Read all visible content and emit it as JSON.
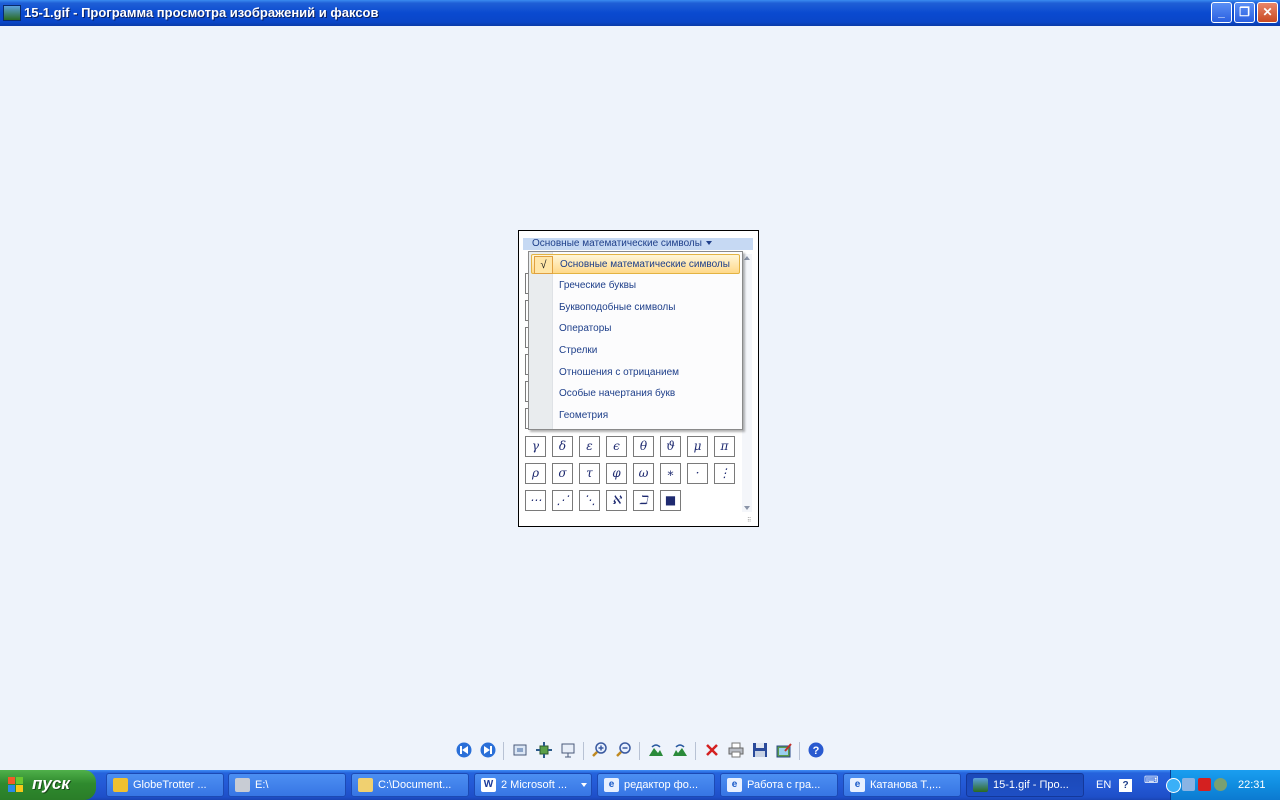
{
  "window": {
    "title": "15-1.gif - Программа просмотра изображений и факсов",
    "minimize_label": "_",
    "restore_label": "❐",
    "close_label": "✕"
  },
  "symbols_panel": {
    "header": "Основные математические символы",
    "menu_items": [
      {
        "label": "Основные математические символы",
        "selected": true
      },
      {
        "label": "Греческие буквы"
      },
      {
        "label": "Буквоподобные символы"
      },
      {
        "label": "Операторы"
      },
      {
        "label": "Стрелки"
      },
      {
        "label": "Отношения с отрицанием"
      },
      {
        "label": "Особые начертания букв"
      },
      {
        "label": "Геометрия"
      }
    ],
    "check_glyph": "√",
    "symbol_rows": [
      [
        "γ",
        "δ",
        "ε",
        "ϵ",
        "θ",
        "ϑ",
        "μ",
        "π"
      ],
      [
        "ρ",
        "σ",
        "τ",
        "φ",
        "ω",
        "∗",
        "·",
        "⋮"
      ],
      [
        "⋯",
        "⋰",
        "⋱",
        "ℵ",
        "ℶ",
        "■"
      ]
    ]
  },
  "viewer_toolbar": {
    "icons": [
      "previous-image-icon",
      "next-image-icon",
      "best-fit-icon",
      "actual-size-icon",
      "slideshow-icon",
      "zoom-in-icon",
      "zoom-out-icon",
      "rotate-clockwise-icon",
      "rotate-counterclockwise-icon",
      "delete-icon",
      "print-icon",
      "save-icon",
      "edit-icon",
      "help-icon"
    ]
  },
  "taskbar": {
    "start_label": "пуск",
    "buttons": [
      {
        "label": "GlobeTrotter ...",
        "icon": "globetrotter-icon"
      },
      {
        "label": "E:\\",
        "icon": "drive-icon"
      },
      {
        "label": "C:\\Document...",
        "icon": "folder-icon"
      },
      {
        "label": "2 Microsoft ...",
        "icon": "word-icon",
        "icon_glyph": "W"
      },
      {
        "label": "редактор фо...",
        "icon": "ie-icon",
        "icon_glyph": "e"
      },
      {
        "label": "Работа с гра...",
        "icon": "ie-icon",
        "icon_glyph": "e"
      },
      {
        "label": "Катанова Т.,...",
        "icon": "ie-icon",
        "icon_glyph": "e"
      },
      {
        "label": "15-1.gif - Про...",
        "icon": "image-viewer-icon",
        "active": true
      }
    ],
    "tray": {
      "language": "EN",
      "help_glyph": "?",
      "clock": "22:31"
    }
  },
  "colors": {
    "titlebar": "#0a4ad0",
    "taskbar": "#2459d6",
    "start_button": "#2f8a2e",
    "menu_highlight": "#ffd98a",
    "background": "#eef3fb"
  }
}
